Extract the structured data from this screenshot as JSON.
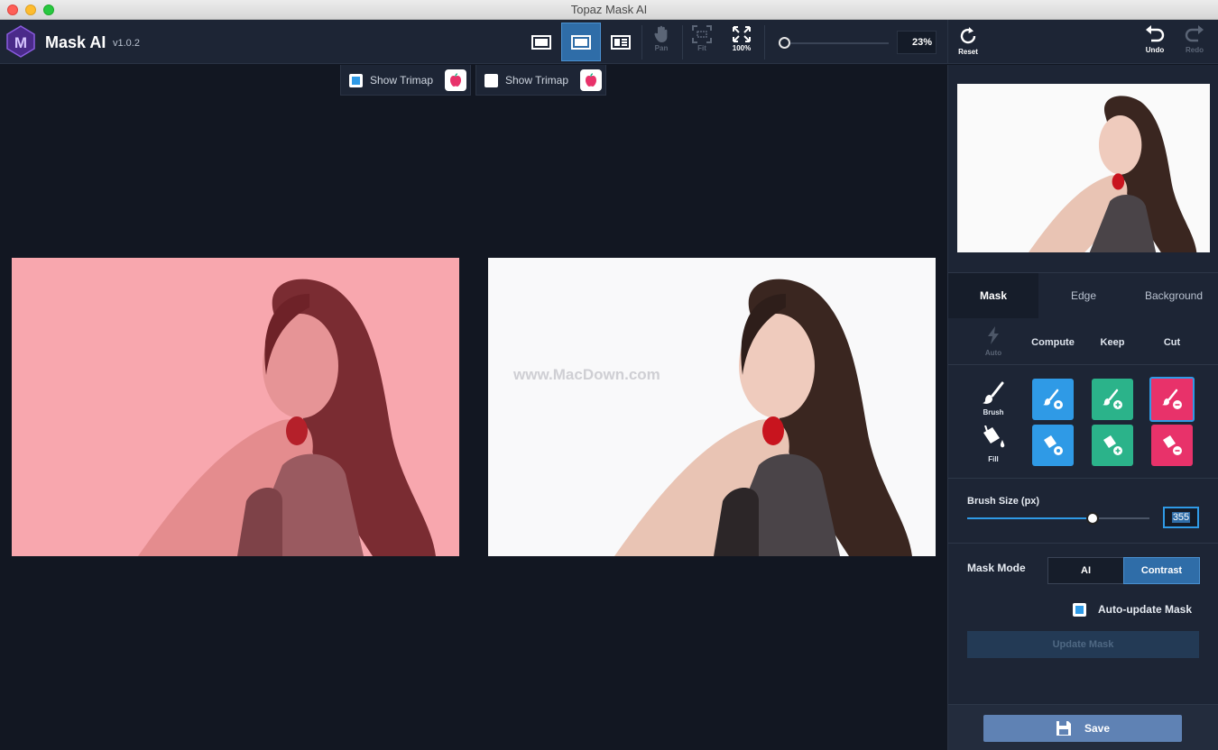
{
  "window": {
    "title": "Topaz Mask AI"
  },
  "app": {
    "name": "Mask AI",
    "version": "v1.0.2"
  },
  "toolbar": {
    "pan_label": "Pan",
    "fit_label": "Fit",
    "actual_label": "100%",
    "zoom_value": "23%",
    "reset_label": "Reset",
    "undo_label": "Undo",
    "redo_label": "Redo"
  },
  "trimap": [
    {
      "label": "Show Trimap",
      "checked": true
    },
    {
      "label": "Show Trimap",
      "checked": false
    }
  ],
  "canvas": {
    "watermark": "www.MacDown.com"
  },
  "tabs": [
    "Mask",
    "Edge",
    "Background"
  ],
  "mask_tools": {
    "columns": [
      "Compute",
      "Keep",
      "Cut"
    ],
    "auto_label": "Auto",
    "brush_label": "Brush",
    "fill_label": "Fill"
  },
  "brush_size": {
    "label": "Brush Size (px)",
    "value": "355"
  },
  "mask_mode": {
    "label": "Mask Mode",
    "options": [
      "AI",
      "Contrast"
    ],
    "selected": "Contrast"
  },
  "auto_update": {
    "label": "Auto-update Mask",
    "checked": true
  },
  "update_button": "Update Mask",
  "save_button": "Save",
  "colors": {
    "compute": "#2f9ae6",
    "keep": "#2bb38a",
    "cut": "#e8326a",
    "accent": "#2f6da8"
  }
}
